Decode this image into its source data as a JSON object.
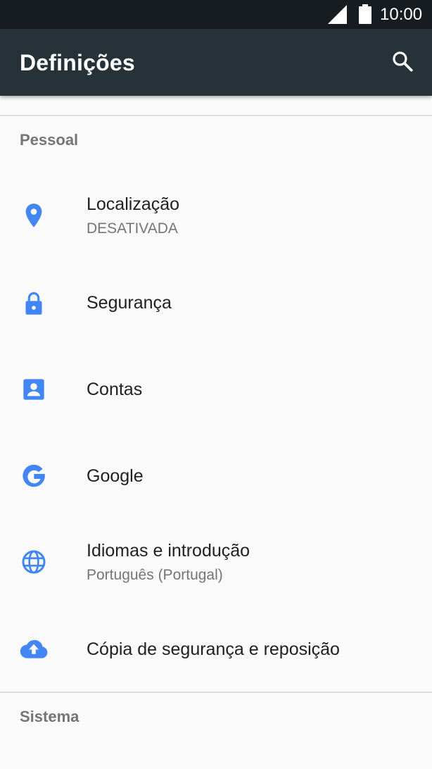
{
  "status_bar": {
    "time": "10:00",
    "icons": [
      "signal-icon",
      "battery-icon"
    ]
  },
  "app_bar": {
    "title": "Definições",
    "search_icon": "search-icon"
  },
  "colors": {
    "app_bar": "#263238",
    "status_bar": "#171c20",
    "accent_icon": "#4285f4",
    "background": "#fafafa"
  },
  "sections": [
    {
      "header": "Pessoal",
      "items": [
        {
          "title": "Localização",
          "summary": "DESATIVADA",
          "icon": "location-pin-icon"
        },
        {
          "title": "Segurança",
          "summary": "",
          "icon": "lock-icon"
        },
        {
          "title": "Contas",
          "summary": "",
          "icon": "account-box-icon"
        },
        {
          "title": "Google",
          "summary": "",
          "icon": "google-g-icon"
        },
        {
          "title": "Idiomas e introdução",
          "summary": "Português (Portugal)",
          "icon": "globe-icon"
        },
        {
          "title": "Cópia de segurança e reposição",
          "summary": "",
          "icon": "cloud-upload-icon"
        }
      ]
    },
    {
      "header": "Sistema",
      "items": []
    }
  ]
}
